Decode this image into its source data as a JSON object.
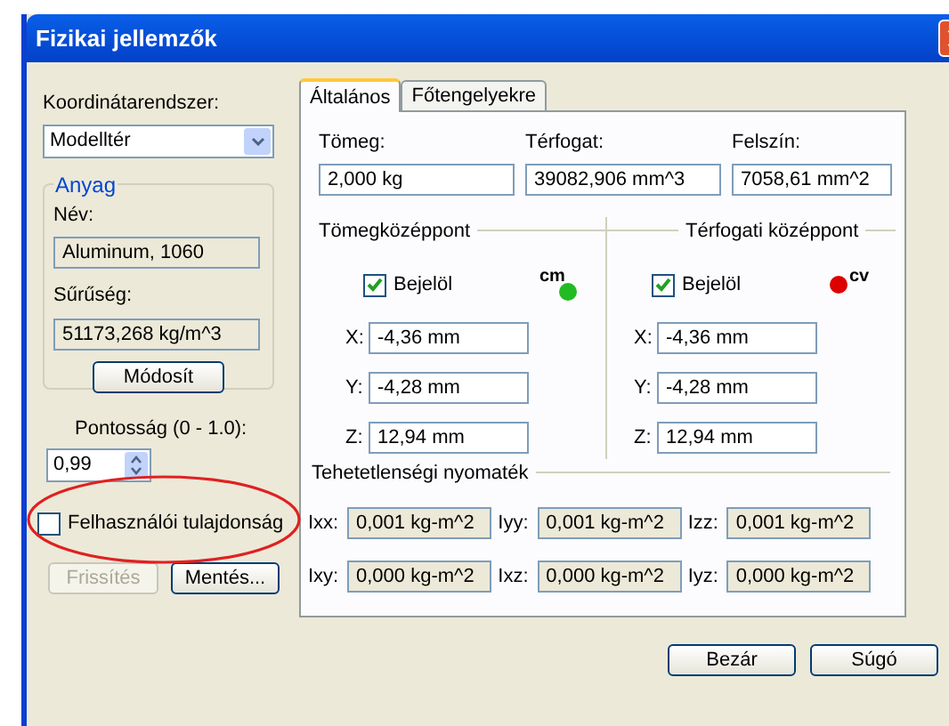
{
  "window": {
    "title": "Fizikai jellemzők"
  },
  "left": {
    "coordinate_system": {
      "label": "Koordinátarendszer:",
      "value": "Modelltér"
    },
    "material": {
      "title": "Anyag",
      "name_label": "Név:",
      "name_value": "Aluminum, 1060",
      "density_label": "Sűrűség:",
      "density_value": "51173,268 kg/m^3",
      "button": "Módosít"
    },
    "precision": {
      "label": "Pontosság (0 - 1.0):",
      "value": "0,99"
    },
    "user_property": {
      "label": "Felhasználói tulajdonság",
      "checked": false,
      "highlighted": true
    },
    "buttons": [
      {
        "label": "Frissítés",
        "disabled": true
      },
      {
        "label": "Mentés...",
        "disabled": false
      }
    ]
  },
  "tabs": [
    {
      "label": "Általános",
      "selected": true
    },
    {
      "label": "Főtengelyekre",
      "selected": false
    }
  ],
  "general": {
    "fields": [
      {
        "label": "Tömeg:",
        "value": "2,000 kg"
      },
      {
        "label": "Térfogat:",
        "value": "39082,906 mm^3"
      },
      {
        "label": "Felszín:",
        "value": "7058,61 mm^2"
      }
    ],
    "centers": [
      {
        "title": "Tömegközéppont",
        "checkbox": {
          "label": "Bejelöl",
          "checked": true
        },
        "marker": {
          "text": "cm",
          "color": "#22bb22"
        },
        "coords": [
          {
            "label": "X:",
            "value": "-4,36 mm"
          },
          {
            "label": "Y:",
            "value": "-4,28 mm"
          },
          {
            "label": "Z:",
            "value": "12,94 mm"
          }
        ]
      },
      {
        "title": "Térfogati középpont",
        "checkbox": {
          "label": "Bejelöl",
          "checked": true
        },
        "marker": {
          "text": "cv",
          "color": "#dd0000"
        },
        "coords": [
          {
            "label": "X:",
            "value": "-4,36 mm"
          },
          {
            "label": "Y:",
            "value": "-4,28 mm"
          },
          {
            "label": "Z:",
            "value": "12,94 mm"
          }
        ]
      }
    ],
    "inertia": {
      "title": "Tehetetlenségi nyomaték",
      "cells": [
        {
          "label": "Ixx:",
          "value": "0,001 kg-m^2"
        },
        {
          "label": "Iyy:",
          "value": "0,001 kg-m^2"
        },
        {
          "label": "Izz:",
          "value": "0,001 kg-m^2"
        },
        {
          "label": "Ixy:",
          "value": "0,000 kg-m^2"
        },
        {
          "label": "Ixz:",
          "value": "0,000 kg-m^2"
        },
        {
          "label": "Iyz:",
          "value": "0,000 kg-m^2"
        }
      ]
    }
  },
  "footer_buttons": [
    "Bezár",
    "Súgó"
  ]
}
